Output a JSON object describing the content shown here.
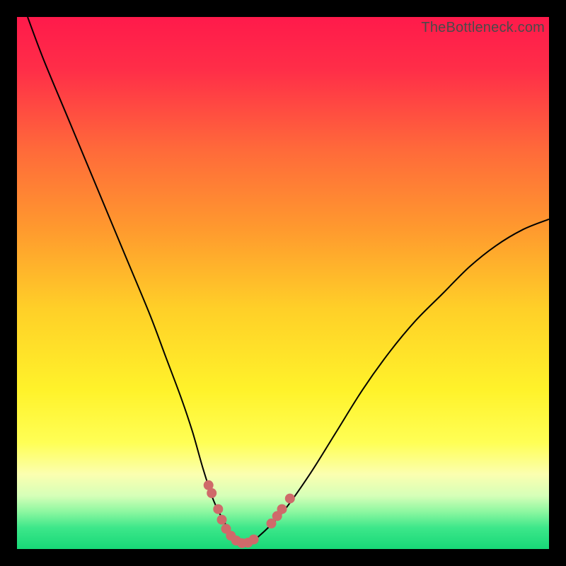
{
  "watermark": "TheBottleneck.com",
  "chart_data": {
    "type": "line",
    "title": "",
    "xlabel": "",
    "ylabel": "",
    "xlim": [
      0,
      100
    ],
    "ylim": [
      0,
      100
    ],
    "grid": false,
    "legend": false,
    "series": [
      {
        "name": "bottleneck-curve",
        "color": "#000000",
        "x": [
          2,
          5,
          10,
          15,
          20,
          25,
          28,
          31,
          33,
          35,
          37,
          39,
          41,
          43,
          45,
          50,
          55,
          60,
          65,
          70,
          75,
          80,
          85,
          90,
          95,
          100
        ],
        "y": [
          100,
          92,
          80,
          68,
          56,
          44,
          36,
          28,
          22,
          15,
          9,
          5,
          2,
          1,
          2,
          7,
          14,
          22,
          30,
          37,
          43,
          48,
          53,
          57,
          60,
          62
        ]
      }
    ],
    "markers": [
      {
        "cluster": "left",
        "x": 36.0,
        "y": 12.0
      },
      {
        "cluster": "left",
        "x": 36.6,
        "y": 10.5
      },
      {
        "cluster": "left",
        "x": 37.8,
        "y": 7.5
      },
      {
        "cluster": "left",
        "x": 38.5,
        "y": 5.5
      },
      {
        "cluster": "left",
        "x": 39.3,
        "y": 3.8
      },
      {
        "cluster": "left",
        "x": 40.2,
        "y": 2.5
      },
      {
        "cluster": "left",
        "x": 41.2,
        "y": 1.6
      },
      {
        "cluster": "left",
        "x": 42.3,
        "y": 1.1
      },
      {
        "cluster": "left",
        "x": 43.4,
        "y": 1.2
      },
      {
        "cluster": "left",
        "x": 44.5,
        "y": 1.8
      },
      {
        "cluster": "right",
        "x": 47.8,
        "y": 4.8
      },
      {
        "cluster": "right",
        "x": 48.9,
        "y": 6.2
      },
      {
        "cluster": "right",
        "x": 49.8,
        "y": 7.5
      },
      {
        "cluster": "right",
        "x": 51.3,
        "y": 9.5
      }
    ],
    "marker_style": {
      "color": "#cf6a6a",
      "radius_px": 7
    },
    "background_gradient_stops": [
      {
        "offset": 0.0,
        "color": "#ff1a4b"
      },
      {
        "offset": 0.1,
        "color": "#ff2e48"
      },
      {
        "offset": 0.25,
        "color": "#ff6a3a"
      },
      {
        "offset": 0.4,
        "color": "#ff9a2e"
      },
      {
        "offset": 0.55,
        "color": "#ffd028"
      },
      {
        "offset": 0.7,
        "color": "#fff22a"
      },
      {
        "offset": 0.8,
        "color": "#ffff55"
      },
      {
        "offset": 0.86,
        "color": "#fbffb0"
      },
      {
        "offset": 0.9,
        "color": "#d6ffb8"
      },
      {
        "offset": 0.93,
        "color": "#8cf7a0"
      },
      {
        "offset": 0.96,
        "color": "#3de78a"
      },
      {
        "offset": 1.0,
        "color": "#17d877"
      }
    ]
  }
}
